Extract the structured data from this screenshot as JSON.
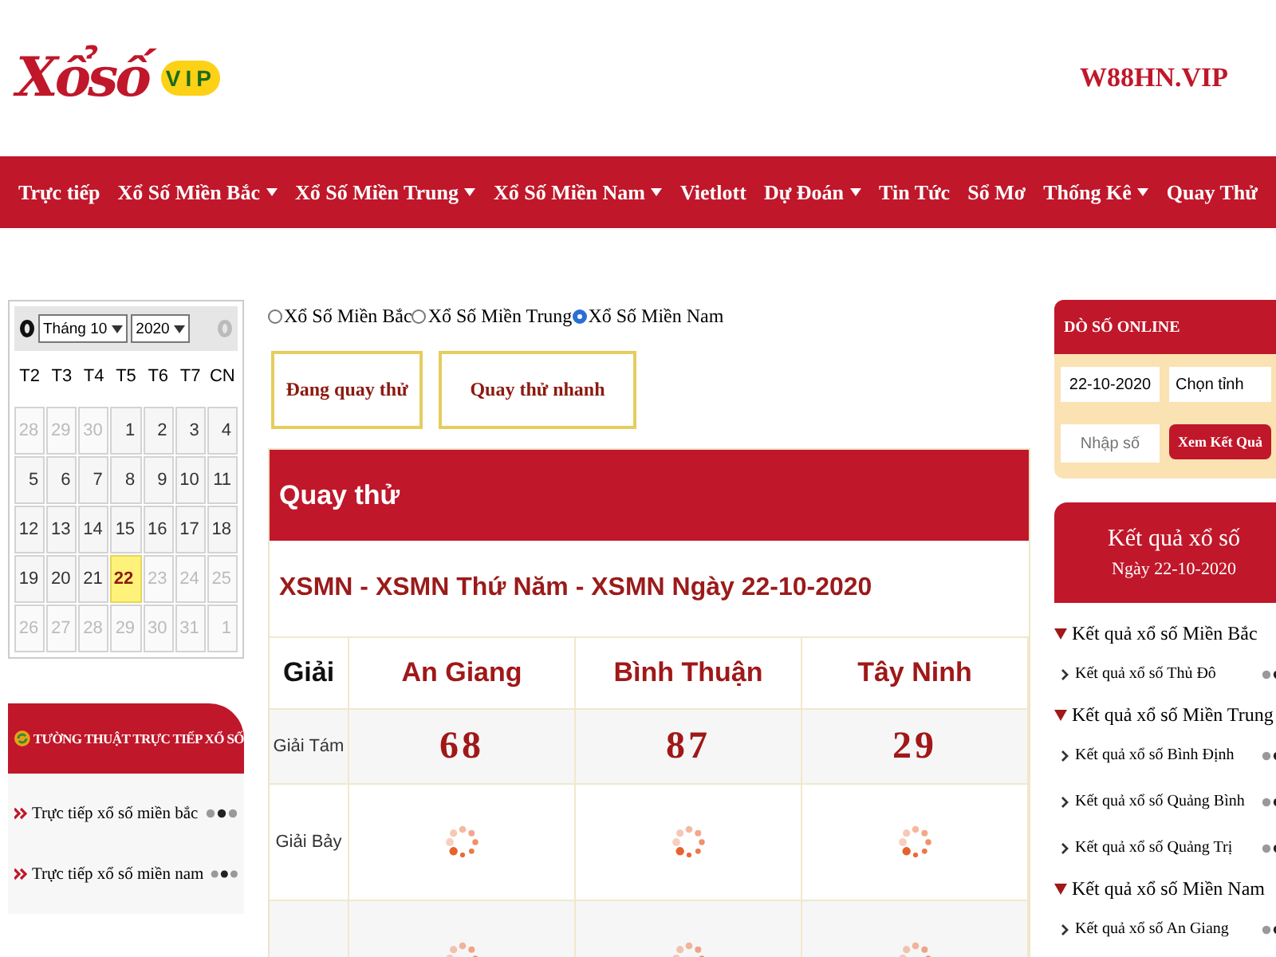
{
  "logo": {
    "text": "Xổsố",
    "badge": "VIP"
  },
  "site_link": "W88HN.VIP",
  "nav": [
    {
      "label": "Trực tiếp",
      "dropdown": false
    },
    {
      "label": "Xổ Số Miền Bắc",
      "dropdown": true
    },
    {
      "label": "Xổ Số Miền Trung",
      "dropdown": true
    },
    {
      "label": "Xổ Số Miền Nam",
      "dropdown": true
    },
    {
      "label": "Vietlott",
      "dropdown": false
    },
    {
      "label": "Dự Đoán",
      "dropdown": true
    },
    {
      "label": "Tin Tức",
      "dropdown": false
    },
    {
      "label": "Sổ Mơ",
      "dropdown": false
    },
    {
      "label": "Thống Kê",
      "dropdown": true
    },
    {
      "label": "Quay Thử",
      "dropdown": false
    }
  ],
  "calendar": {
    "month": "Tháng 10",
    "year": "2020",
    "weekdays": [
      "T2",
      "T3",
      "T4",
      "T5",
      "T6",
      "T7",
      "CN"
    ],
    "days": [
      {
        "day": "28",
        "muted": true,
        "selected": false
      },
      {
        "day": "29",
        "muted": true,
        "selected": false
      },
      {
        "day": "30",
        "muted": true,
        "selected": false
      },
      {
        "day": "1",
        "muted": false,
        "selected": false
      },
      {
        "day": "2",
        "muted": false,
        "selected": false
      },
      {
        "day": "3",
        "muted": false,
        "selected": false
      },
      {
        "day": "4",
        "muted": false,
        "selected": false
      },
      {
        "day": "5",
        "muted": false,
        "selected": false
      },
      {
        "day": "6",
        "muted": false,
        "selected": false
      },
      {
        "day": "7",
        "muted": false,
        "selected": false
      },
      {
        "day": "8",
        "muted": false,
        "selected": false
      },
      {
        "day": "9",
        "muted": false,
        "selected": false
      },
      {
        "day": "10",
        "muted": false,
        "selected": false
      },
      {
        "day": "11",
        "muted": false,
        "selected": false
      },
      {
        "day": "12",
        "muted": false,
        "selected": false
      },
      {
        "day": "13",
        "muted": false,
        "selected": false
      },
      {
        "day": "14",
        "muted": false,
        "selected": false
      },
      {
        "day": "15",
        "muted": false,
        "selected": false
      },
      {
        "day": "16",
        "muted": false,
        "selected": false
      },
      {
        "day": "17",
        "muted": false,
        "selected": false
      },
      {
        "day": "18",
        "muted": false,
        "selected": false
      },
      {
        "day": "19",
        "muted": false,
        "selected": false
      },
      {
        "day": "20",
        "muted": false,
        "selected": false
      },
      {
        "day": "21",
        "muted": false,
        "selected": false
      },
      {
        "day": "22",
        "muted": false,
        "selected": true
      },
      {
        "day": "23",
        "muted": true,
        "selected": false
      },
      {
        "day": "24",
        "muted": true,
        "selected": false
      },
      {
        "day": "25",
        "muted": true,
        "selected": false
      },
      {
        "day": "26",
        "muted": true,
        "selected": false
      },
      {
        "day": "27",
        "muted": true,
        "selected": false
      },
      {
        "day": "28",
        "muted": true,
        "selected": false
      },
      {
        "day": "29",
        "muted": true,
        "selected": false
      },
      {
        "day": "30",
        "muted": true,
        "selected": false
      },
      {
        "day": "31",
        "muted": true,
        "selected": false
      },
      {
        "day": "1",
        "muted": true,
        "selected": false
      }
    ]
  },
  "live_panel": {
    "title": "TƯỜNG THUẬT TRỰC TIẾP XỔ SỐ",
    "items": [
      "Trực tiếp xổ số miền bắc",
      "Trực tiếp xổ số miền nam"
    ]
  },
  "regions": [
    {
      "label": "Xổ Số Miền Bắc",
      "selected": false
    },
    {
      "label": "Xổ Số Miền Trung",
      "selected": false
    },
    {
      "label": "Xổ Số Miền Nam",
      "selected": true
    }
  ],
  "mode_buttons": [
    "Đang quay thử",
    "Quay thử nhanh"
  ],
  "results": {
    "title": "Quay thử",
    "heading": "XSMN - XSMN Thứ Năm - XSMN Ngày 22-10-2020",
    "prize_header": "Giải",
    "columns": [
      "An Giang",
      "Bình Thuận",
      "Tây Ninh"
    ],
    "rows": [
      {
        "prize": "Giải Tám",
        "cells": [
          {
            "kind": "number",
            "text": "68"
          },
          {
            "kind": "number",
            "text": "87"
          },
          {
            "kind": "number",
            "text": "29"
          }
        ]
      },
      {
        "prize": "Giải Bảy",
        "cells": [
          {
            "kind": "loading"
          },
          {
            "kind": "loading"
          },
          {
            "kind": "loading"
          }
        ]
      },
      {
        "cells": [
          {
            "kind": "loading"
          },
          {
            "kind": "loading"
          },
          {
            "kind": "loading"
          }
        ]
      }
    ]
  },
  "check_panel": {
    "title": "DÒ SỐ ONLINE",
    "date": "22-10-2020",
    "province": "Chọn tỉnh",
    "number_placeholder": "Nhập số",
    "button": "Xem Kết Quả"
  },
  "result_links": {
    "title": "Kết quả xổ số",
    "date": "Ngày 22-10-2020",
    "groups": [
      {
        "label": "Kết quả xổ số Miền Bắc",
        "expanded": true,
        "children": [
          {
            "label": "Kết quả xổ số Thủ Đô"
          }
        ]
      },
      {
        "label": "Kết quả xổ số Miền Trung",
        "expanded": true,
        "children": [
          {
            "label": "Kết quả xổ số Bình Định"
          },
          {
            "label": "Kết quả xổ số Quảng Bình"
          },
          {
            "label": "Kết quả xổ số Quảng Trị"
          }
        ]
      },
      {
        "label": "Kết quả xổ số Miền Nam",
        "expanded": true,
        "children": [
          {
            "label": "Kết quả xổ số An Giang"
          }
        ]
      }
    ]
  }
}
